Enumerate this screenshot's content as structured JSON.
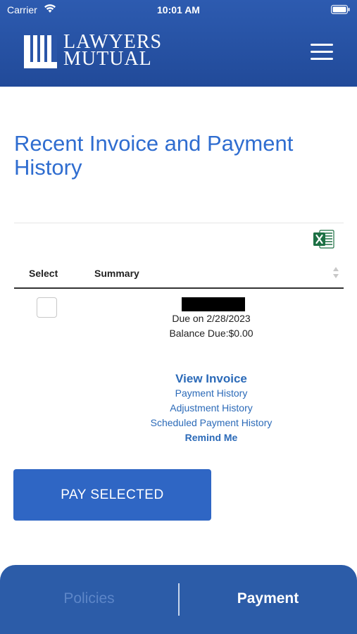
{
  "status_bar": {
    "carrier": "Carrier",
    "time": "10:01 AM",
    "icons": [
      "wifi-icon",
      "battery-icon"
    ]
  },
  "header": {
    "logo_line1": "LAWYERS",
    "logo_line2": "MUTUAL",
    "menu_icon": "hamburger-menu-icon",
    "colors": {
      "header_bg": "#2d5bb0",
      "accent": "#2f6dd0"
    }
  },
  "main": {
    "title": "Recent Invoice and Payment History",
    "export_icon": "excel-icon",
    "table": {
      "columns": [
        "Select",
        "Summary"
      ],
      "rows": [
        {
          "selected": false,
          "due": "Due on 2/28/2023",
          "balance": "Balance Due:$0.00"
        }
      ]
    },
    "links": {
      "view_invoice": "View Invoice",
      "payment_history": "Payment History",
      "adjustment_history": "Adjustment History",
      "scheduled_payment_history": "Scheduled Payment History",
      "remind_me": "Remind Me"
    },
    "pay_button": "PAY SELECTED"
  },
  "tabbar": {
    "tabs": [
      {
        "label": "Policies",
        "active": false
      },
      {
        "label": "Payment",
        "active": true
      }
    ]
  }
}
